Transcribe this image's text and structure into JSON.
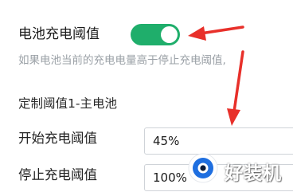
{
  "colors": {
    "toggle_on": "#1fae6b",
    "annotation_arrow": "#e8302a",
    "description_text": "#9aa0a6"
  },
  "charging_threshold": {
    "title": "电池充电阈值",
    "toggle_on": true,
    "description": "如果电池当前的充电电量高于停止充电阈值,"
  },
  "custom_threshold": {
    "title": "定制阈值1-主电池",
    "start_label": "开始充电阈值",
    "start_value": "45%",
    "stop_label": "停止充电阈值",
    "stop_value": "100%"
  },
  "annotations": {
    "arrow_count": 2
  },
  "watermark": {
    "text": "好装机",
    "icon": "eye-logo-icon"
  }
}
